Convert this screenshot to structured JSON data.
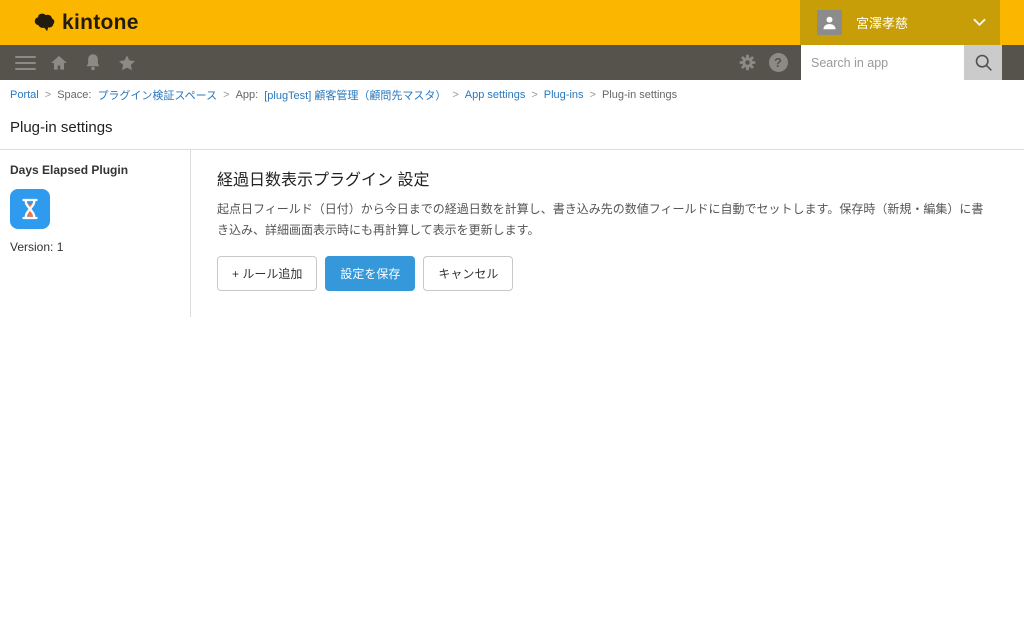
{
  "header": {
    "logo_text": "kintone",
    "user": {
      "name": "宮澤孝慈"
    }
  },
  "toolbar": {
    "help_glyph": "?",
    "search": {
      "placeholder": "Search in app",
      "value": ""
    }
  },
  "breadcrumb": {
    "separator": ">",
    "items": [
      {
        "label": "Portal",
        "link": true
      },
      {
        "prefix": "Space:",
        "label": "プラグイン検証スペース",
        "link": true
      },
      {
        "prefix": "App:",
        "label": "[plugTest] 顧客管理（顧問先マスタ）",
        "link": true
      },
      {
        "label": "App settings",
        "link": true
      },
      {
        "label": "Plug-ins",
        "link": true
      },
      {
        "label": "Plug-in settings",
        "link": false
      }
    ]
  },
  "page": {
    "title": "Plug-in settings"
  },
  "sidebar": {
    "plugin_name": "Days Elapsed Plugin",
    "version_label": "Version: 1"
  },
  "main": {
    "heading": "経過日数表示プラグイン 設定",
    "description": "起点日フィールド（日付）から今日までの経過日数を計算し、書き込み先の数値フィールドに自動でセットします。保存時（新規・編集）に書き込み、詳細画面表示時にも再計算して表示を更新します。",
    "buttons": {
      "add_rule": "+ ルール追加",
      "save": "設定を保存",
      "cancel": "キャンセル"
    }
  },
  "icons": {
    "hamburger": "three-bars",
    "home": "house-glyph",
    "notifications": "bell-glyph",
    "favorites": "star-glyph",
    "settings": "gear-glyph",
    "help": "?",
    "search": "magnifier-glyph",
    "user": "person-silhouette",
    "chevron_down": "v-shape",
    "plugin": "hourglass-on-blue-square"
  },
  "colors": {
    "brand_yellow": "#fbb600",
    "user_area_gold": "#c79e08",
    "toolbar_dark": "#56524c",
    "toolbar_icon_gray": "#8d8a85",
    "link_blue": "#2878be",
    "primary_button_blue": "#3498db",
    "plugin_icon_blue": "#2e9bef",
    "plugin_icon_sand_orange": "#ee7350"
  }
}
